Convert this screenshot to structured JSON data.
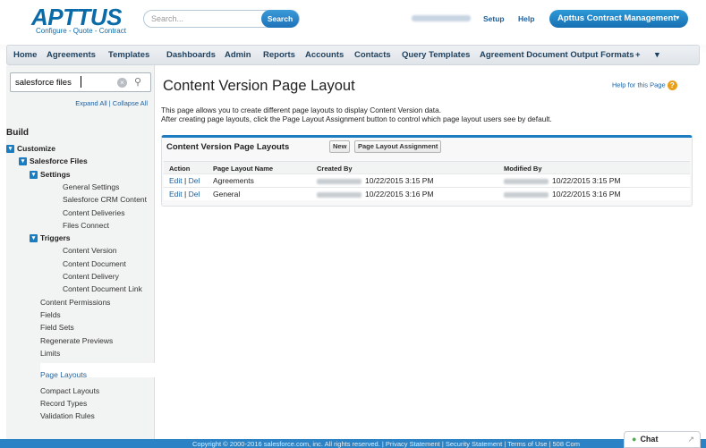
{
  "header": {
    "logo": "APTTUS",
    "tagline": "Configure - Quote - Contract",
    "search_placeholder": "Search...",
    "search_button": "Search",
    "setup": "Setup",
    "help": "Help",
    "app_menu": "Apttus Contract Management",
    "app_menu_caret": "▾"
  },
  "tabs": [
    "Home",
    "Agreements",
    "Templates",
    "Dashboards",
    "Admin",
    "Reports",
    "Accounts",
    "Contacts",
    "Query Templates",
    "Agreement Document Output Formats",
    "+",
    "▾"
  ],
  "sidebar": {
    "quick_find": "salesforce files",
    "expand_all": "Expand All | Collapse All",
    "build": "Build",
    "items": [
      {
        "label": "Customize",
        "bold": true,
        "toggle": true,
        "level": 0
      },
      {
        "label": "Salesforce Files",
        "bold": true,
        "toggle": true,
        "level": 1
      },
      {
        "label": "Settings",
        "bold": true,
        "toggle": true,
        "level": 2
      },
      {
        "label": "General Settings",
        "level": 3
      },
      {
        "label": "Salesforce CRM Content",
        "level": 3
      },
      {
        "label": "Content Deliveries",
        "level": 3
      },
      {
        "label": "Files Connect",
        "level": 3
      },
      {
        "label": "Triggers",
        "bold": true,
        "toggle": true,
        "level": 2
      },
      {
        "label": "Content Version",
        "level": 3
      },
      {
        "label": "Content Document",
        "level": 3
      },
      {
        "label": "Content Delivery",
        "level": 3
      },
      {
        "label": "Content Document Link",
        "level": 3
      },
      {
        "label": "Content Permissions",
        "level": 2
      },
      {
        "label": "Fields",
        "level": 2
      },
      {
        "label": "Field Sets",
        "level": 2
      },
      {
        "label": "Regenerate Previews",
        "level": 2
      },
      {
        "label": "Limits",
        "level": 2
      },
      {
        "label": "Page Layouts",
        "level": 2,
        "selected": true
      },
      {
        "label": "Compact Layouts",
        "level": 2
      },
      {
        "label": "Record Types",
        "level": 2
      },
      {
        "label": "Validation Rules",
        "level": 2
      }
    ]
  },
  "main": {
    "title": "Content Version Page Layout",
    "help_link": "Help for this Page",
    "desc1": "This page allows you to create different page layouts to display Content Version data.",
    "desc2": "After creating page layouts, click the Page Layout Assignment button to control which page layout users see by default.",
    "panel_title": "Content Version Page Layouts",
    "new_button": "New",
    "assign_button": "Page Layout Assignment",
    "columns": [
      "Action",
      "Page Layout Name",
      "Created By",
      "Modified By"
    ],
    "rows": [
      {
        "edit": "Edit",
        "del": "Del",
        "name": "Agreements",
        "created": "10/22/2015 3:15 PM",
        "modified": "10/22/2015 3:15 PM"
      },
      {
        "edit": "Edit",
        "del": "Del",
        "name": "General",
        "created": "10/22/2015 3:16 PM",
        "modified": "10/22/2015 3:16 PM"
      }
    ]
  },
  "footer": {
    "text": "Copyright © 2000-2016 salesforce.com, inc. All rights reserved. | Privacy Statement | Security Statement | Terms of Use | 508 Com",
    "chat": "Chat"
  }
}
